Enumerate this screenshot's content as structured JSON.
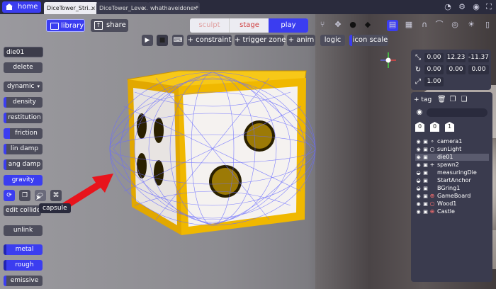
{
  "tabbar": {
    "home_label": "home",
    "tabs": [
      {
        "label": "DiceTower_Stri...",
        "close": "×"
      },
      {
        "label": "DiceTower_Leve...",
        "close": "×"
      },
      {
        "label": "whathaveidone *",
        "close": "×"
      }
    ]
  },
  "toolbar": {
    "library_label": "library",
    "share_label": "share",
    "modes": {
      "sculpt": "sculpt",
      "stage": "stage",
      "play": "play"
    },
    "constraint_label": "+ constraint",
    "trigger_zone_label": "+ trigger zone",
    "anim_label": "+ anim",
    "logic_label": "logic",
    "icon_scale_label": "icon scale"
  },
  "left_panel": {
    "name_value": "die01",
    "delete_label": "delete",
    "body_type_value": "dynamic",
    "density_label": "density",
    "restitution_label": "restitution",
    "friction_label": "friction",
    "lin_damp_label": "lin damp",
    "ang_damp_label": "ang damp",
    "gravity_label": "gravity",
    "edit_collider_label": "edit collider",
    "tooltip_label": "capsule",
    "unlink_label": "unlink",
    "metal_label": "metal",
    "rough_label": "rough",
    "emissive_label": "emissive"
  },
  "transform": {
    "position": [
      "0.00",
      "12.23",
      "-11.37"
    ],
    "rotation": [
      "0.00",
      "0.00",
      "0.00"
    ],
    "scale": "1.00"
  },
  "hierarchy": {
    "tag_label": "tag",
    "tag_counts": [
      "0",
      "0",
      "1"
    ],
    "items": [
      {
        "name": "camera1",
        "glyph": "∘",
        "selected": false
      },
      {
        "name": "sunLight",
        "glyph": "○",
        "selected": false
      },
      {
        "name": "die01",
        "glyph": "",
        "selected": true
      },
      {
        "name": "spawn2",
        "glyph": "+",
        "selected": false
      },
      {
        "name": "measuringDie",
        "glyph": "",
        "selected": false
      },
      {
        "name": "StartAnchor",
        "glyph": "",
        "selected": false
      },
      {
        "name": "BGring1",
        "glyph": "",
        "selected": false
      },
      {
        "name": "GameBoard",
        "glyph": "⊕",
        "selected": false
      },
      {
        "name": "Wood1",
        "glyph": "○",
        "selected": false
      },
      {
        "name": "Castle",
        "glyph": "⊕",
        "selected": false
      }
    ]
  },
  "colors": {
    "accent": "#3b3df0",
    "panel": "#3a3b4e",
    "button": "#4d4d5c",
    "die_frame": "#f0b800",
    "collider_wire": "#6a6cff",
    "arrow": "#e8141c"
  }
}
